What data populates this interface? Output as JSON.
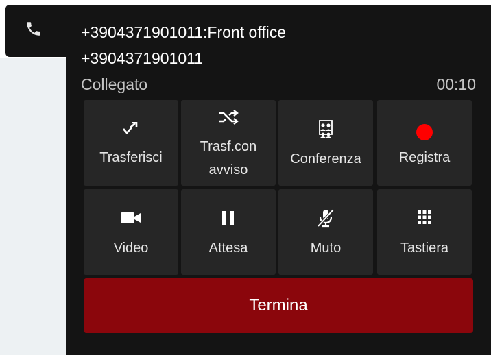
{
  "call": {
    "caller_name": "+3904371901011:Front office",
    "caller_number": "+3904371901011",
    "status": "Collegato",
    "timer": "00:10"
  },
  "actions": [
    {
      "label": "Trasferisci",
      "icon": "transfer-icon"
    },
    {
      "label": "Trasf.con",
      "label2": "avviso",
      "icon": "shuffle-icon"
    },
    {
      "label": "Conferenza",
      "icon": "conference-icon"
    },
    {
      "label": "Registra",
      "icon": "record-icon"
    },
    {
      "label": "Video",
      "icon": "video-camera-icon"
    },
    {
      "label": "Attesa",
      "icon": "pause-icon"
    },
    {
      "label": "Muto",
      "icon": "mic-off-icon"
    },
    {
      "label": "Tastiera",
      "icon": "keypad-icon"
    }
  ],
  "end_call": {
    "label": "Termina"
  },
  "colors": {
    "panel": "#141414",
    "button": "#262626",
    "end_button": "#8b060c",
    "record": "#ff0000"
  }
}
